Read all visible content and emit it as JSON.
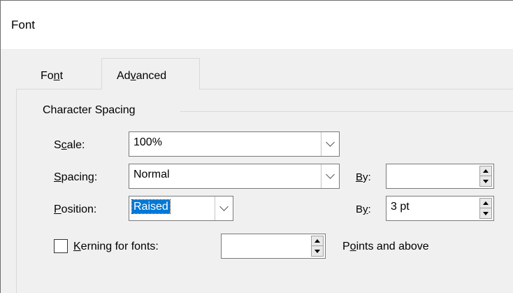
{
  "window": {
    "title": "Font"
  },
  "tabs": [
    {
      "label_pre": "Fo",
      "label_key": "n",
      "label_post": "t",
      "active": false
    },
    {
      "label_pre": "Ad",
      "label_key": "v",
      "label_post": "anced",
      "active": true
    }
  ],
  "group": {
    "label": "Character Spacing"
  },
  "scale": {
    "label_pre": "S",
    "label_key": "c",
    "label_post": "ale:",
    "value": "100%"
  },
  "spacing": {
    "label_pre": "",
    "label_key": "S",
    "label_post": "pacing:",
    "value": "Normal",
    "by_label_key": "B",
    "by_label_post": "y:",
    "by_value": ""
  },
  "position": {
    "label_pre": "",
    "label_key": "P",
    "label_post": "osition:",
    "value": "Raised",
    "by_label_pre": "B",
    "by_label_key": "y",
    "by_label_post": ":",
    "by_value": "3 pt"
  },
  "kerning": {
    "label_pre": "",
    "label_key": "K",
    "label_post": "erning for fonts:",
    "checked": false,
    "value": "",
    "suffix_pre": "P",
    "suffix_key": "o",
    "suffix_post": "ints and above"
  }
}
